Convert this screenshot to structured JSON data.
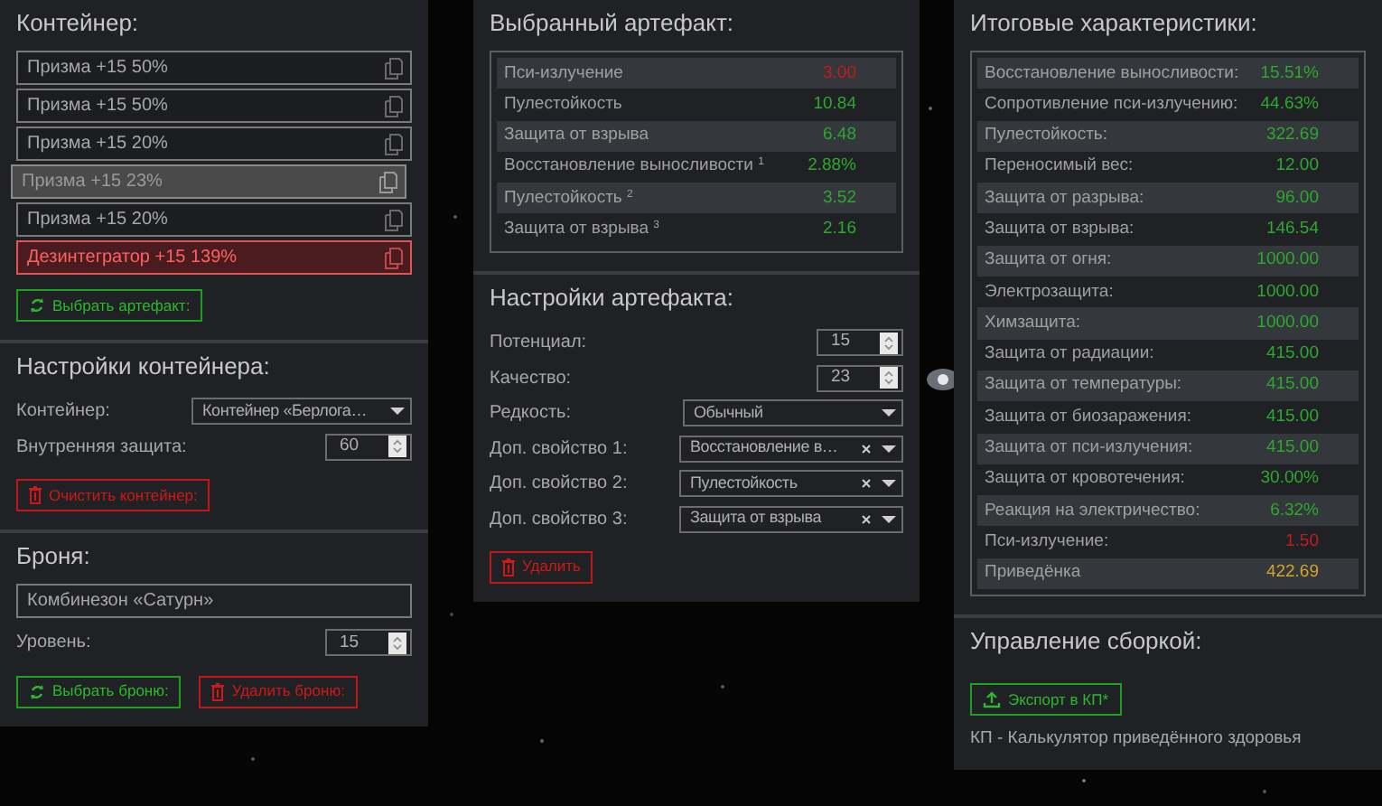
{
  "container": {
    "title": "Контейнер:",
    "items": [
      {
        "label": "Призма +15 50%",
        "selected": false,
        "error": false
      },
      {
        "label": "Призма +15 50%",
        "selected": false,
        "error": false
      },
      {
        "label": "Призма +15 20%",
        "selected": false,
        "error": false
      },
      {
        "label": "Призма +15 23%",
        "selected": true,
        "error": false
      },
      {
        "label": "Призма +15 20%",
        "selected": false,
        "error": false
      },
      {
        "label": "Дезинтегратор +15 139%",
        "selected": false,
        "error": true
      }
    ],
    "buttons": [
      {
        "kind": "select",
        "label": "Выбрать артефакт:"
      }
    ]
  },
  "container_settings": {
    "title": "Настройки контейнера:",
    "fields": [
      {
        "kind": "select",
        "label": "Контейнер:",
        "value": "Контейнер «Берлога…",
        "clearable": false
      },
      {
        "kind": "number",
        "label": "Внутренняя защита:",
        "value": "60"
      }
    ],
    "buttons": [
      {
        "kind": "delete",
        "label": "Очистить контейнер:"
      }
    ]
  },
  "armor": {
    "title": "Броня:",
    "name_field": {
      "value": "Комбинезон «Сатурн»"
    },
    "fields": [
      {
        "kind": "number",
        "label": "Уровень:",
        "value": "15"
      }
    ],
    "buttons": [
      {
        "kind": "select",
        "label": "Выбрать броню:"
      },
      {
        "kind": "delete",
        "label": "Удалить броню:"
      }
    ]
  },
  "artifact": {
    "title": "Выбранный артефакт:",
    "stats": [
      {
        "label": "Пси-излучение",
        "value": "3.00",
        "color": "#c21d1d"
      },
      {
        "label": "Пулестойкость",
        "value": "10.84",
        "color": "#2ea82e"
      },
      {
        "label": "Защита от взрыва",
        "value": "6.48",
        "color": "#2ea82e"
      },
      {
        "label": "Восстановление выносливости $^{1}$",
        "value": "2.88%",
        "color": "#2ea82e"
      },
      {
        "label": "Пулестойкость $^{2}$",
        "value": "3.52",
        "color": "#2ea82e"
      },
      {
        "label": "Защита от взрыва $^{3}$",
        "value": "2.16",
        "color": "#2ea82e"
      }
    ]
  },
  "artifact_settings": {
    "title": "Настройки артефакта:",
    "fields": [
      {
        "kind": "number",
        "label": "Потенциал:",
        "value": "15"
      },
      {
        "kind": "number",
        "label": "Качество:",
        "value": "23"
      },
      {
        "kind": "select",
        "label": "Редкость:",
        "value": "Обычный",
        "clearable": false
      },
      {
        "kind": "select",
        "label": "Доп. свойство 1:",
        "value": "Восстановление в…",
        "clearable": true
      },
      {
        "kind": "select",
        "label": "Доп. свойство 2:",
        "value": "Пулестойкость",
        "clearable": true
      },
      {
        "kind": "select",
        "label": "Доп. свойство 3:",
        "value": "Защита от взрыва",
        "clearable": true
      }
    ],
    "buttons": [
      {
        "kind": "delete",
        "label": "Удалить"
      }
    ]
  },
  "totals": {
    "title": "Итоговые характеристики:",
    "stats": [
      {
        "label": "Восстановление выносливости:",
        "value": "15.51%",
        "color": "#2ea82e"
      },
      {
        "label": "Сопротивление пси-излучению:",
        "value": "44.63%",
        "color": "#2ea82e"
      },
      {
        "label": "Пулестойкость:",
        "value": "322.69",
        "color": "#2ea82e"
      },
      {
        "label": "Переносимый вес:",
        "value": "12.00",
        "color": "#2ea82e"
      },
      {
        "label": "Защита от разрыва:",
        "value": "96.00",
        "color": "#2ea82e"
      },
      {
        "label": "Защита от взрыва:",
        "value": "146.54",
        "color": "#2ea82e"
      },
      {
        "label": "Защита от огня:",
        "value": "1000.00",
        "color": "#2ea82e"
      },
      {
        "label": "Электрозащита:",
        "value": "1000.00",
        "color": "#2ea82e"
      },
      {
        "label": "Химзащита:",
        "value": "1000.00",
        "color": "#2ea82e"
      },
      {
        "label": "Защита от радиации:",
        "value": "415.00",
        "color": "#2ea82e"
      },
      {
        "label": "Защита от температуры:",
        "value": "415.00",
        "color": "#2ea82e"
      },
      {
        "label": "Защита от биозаражения:",
        "value": "415.00",
        "color": "#2ea82e"
      },
      {
        "label": "Защита от пси-излучения:",
        "value": "415.00",
        "color": "#2ea82e"
      },
      {
        "label": "Защита от кровотечения:",
        "value": "30.00%",
        "color": "#2ea82e"
      },
      {
        "label": "Реакция на электричество:",
        "value": "6.32%",
        "color": "#2ea82e"
      },
      {
        "label": "Пси-излучение:",
        "value": "1.50",
        "color": "#c21d1d"
      },
      {
        "label": "Приведёнка",
        "value": "422.69",
        "color": "#d3a52a"
      }
    ]
  },
  "build": {
    "title": "Управление сборкой:",
    "buttons": [
      {
        "kind": "export",
        "label": "Экспорт в КП*"
      }
    ],
    "note": "КП - Калькулятор приведённого здоровья"
  }
}
